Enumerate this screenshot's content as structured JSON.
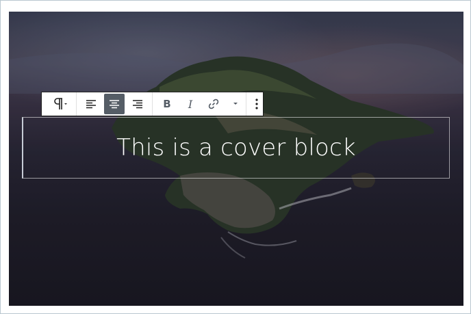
{
  "cover": {
    "text": "This is a cover block"
  },
  "toolbar": {
    "paragraph_icon": "paragraph-icon",
    "align_left_icon": "align-left-icon",
    "align_center_icon": "align-center-icon",
    "align_right_icon": "align-right-icon",
    "bold_label": "B",
    "italic_label": "I",
    "link_icon": "link-icon",
    "more_rich_text_icon": "chevron-down-icon",
    "more_options_icon": "more-vertical-icon",
    "active_alignment": "center"
  },
  "colors": {
    "toolbar_bg": "#ffffff",
    "toolbar_border": "#1e1e1e",
    "active_button_bg": "#555d66",
    "text_color": "#ffffff"
  }
}
